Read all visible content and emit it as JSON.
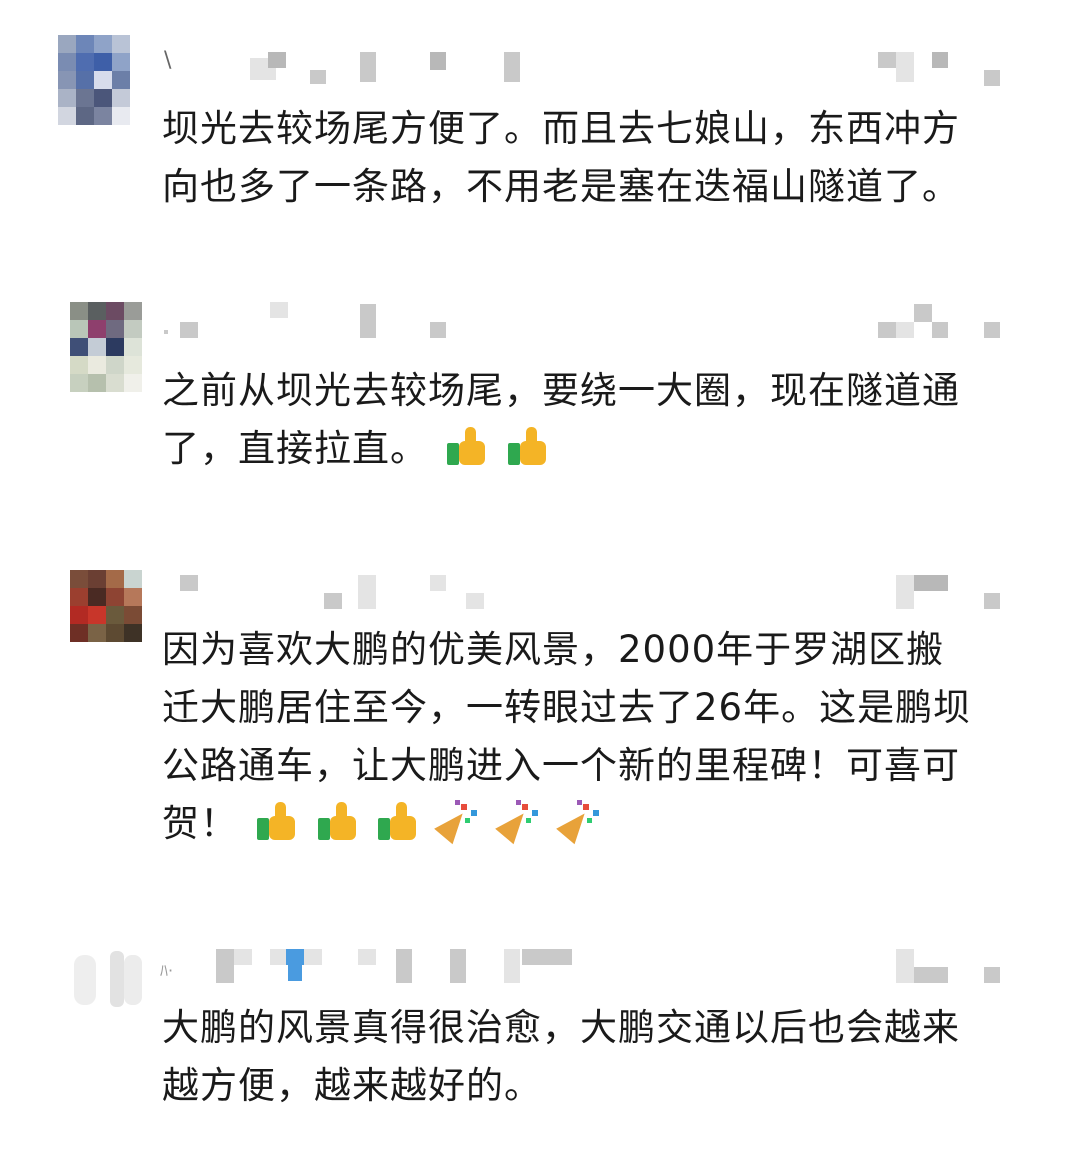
{
  "comments": [
    {
      "text_line1": "坝光去较场尾方便了。而且去七娘山，东西冲方",
      "text_line2": "向也多了一条路，不用老是塞在迭福山隧道了。"
    },
    {
      "text_line1": "之前从坝光去较场尾，要绕一大圈，现在隧道通",
      "text_line2": "了，直接拉直。",
      "emojis": [
        "thumbs-up",
        "thumbs-up"
      ]
    },
    {
      "text_line1": "因为喜欢大鹏的优美风景，2000年于罗湖区搬",
      "text_line2": "迁大鹏居住至今，一转眼过去了26年。这是鹏坝",
      "text_line3": "公路通车，让大鹏进入一个新的里程碑！可喜可",
      "text_line4": "贺！",
      "emojis": [
        "thumbs-up",
        "thumbs-up",
        "thumbs-up",
        "party-popper",
        "party-popper",
        "party-popper"
      ]
    },
    {
      "text_line1": "大鹏的风景真得很治愈，大鹏交通以后也会越来",
      "text_line2": "越方便，越来越好的。"
    }
  ],
  "colors": {
    "text": "#1a1a1a",
    "thumb_hand": "#f4b426",
    "thumb_cuff": "#2fa84f",
    "blur_gray": "#c9c9c9",
    "blur_blue": "#4a9be0"
  }
}
